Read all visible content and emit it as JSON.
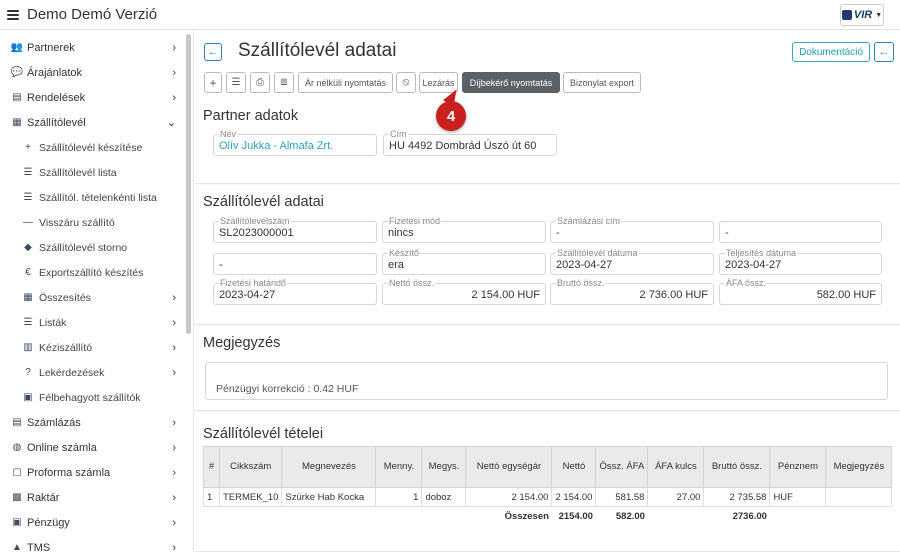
{
  "app": {
    "title": "Demo Demó Verzió",
    "logo_text": "VIR"
  },
  "sidebar": {
    "items": [
      {
        "label": "Partnerek",
        "icon": "users-icon",
        "chevron": "›",
        "sub": false
      },
      {
        "label": "Árajánlatok",
        "icon": "chat-icon",
        "chevron": "›",
        "sub": false
      },
      {
        "label": "Rendelések",
        "icon": "file-icon",
        "chevron": "›",
        "sub": false
      },
      {
        "label": "Szállítólevél",
        "icon": "clipboard-icon",
        "chevron": "⌄",
        "sub": false
      },
      {
        "label": "Szállítólevél készítése",
        "icon": "plus-icon",
        "chevron": "",
        "sub": true
      },
      {
        "label": "Szállítólevél lista",
        "icon": "list-icon",
        "chevron": "",
        "sub": true
      },
      {
        "label": "Szállítól. tételenkénti lista",
        "icon": "list-icon",
        "chevron": "",
        "sub": true
      },
      {
        "label": "Visszáru szállító",
        "icon": "minus-icon",
        "chevron": "",
        "sub": true
      },
      {
        "label": "Szállítólevél storno",
        "icon": "eraser-icon",
        "chevron": "",
        "sub": true
      },
      {
        "label": "Exportszállító készítés",
        "icon": "euro-icon",
        "chevron": "",
        "sub": true
      },
      {
        "label": "Összesítés",
        "icon": "calculator-icon",
        "chevron": "›",
        "sub": true
      },
      {
        "label": "Listák",
        "icon": "list-icon",
        "chevron": "›",
        "sub": true
      },
      {
        "label": "Kéziszállító",
        "icon": "book-icon",
        "chevron": "›",
        "sub": true
      },
      {
        "label": "Lekérdezések",
        "icon": "question-icon",
        "chevron": "›",
        "sub": true
      },
      {
        "label": "Félbehagyott szállítók",
        "icon": "lock-icon",
        "chevron": "",
        "sub": true
      },
      {
        "label": "Számlázás",
        "icon": "invoice-icon",
        "chevron": "›",
        "sub": false
      },
      {
        "label": "Online számla",
        "icon": "globe-icon",
        "chevron": "›",
        "sub": false
      },
      {
        "label": "Proforma számla",
        "icon": "comment-icon",
        "chevron": "›",
        "sub": false
      },
      {
        "label": "Raktár",
        "icon": "warehouse-icon",
        "chevron": "›",
        "sub": false
      },
      {
        "label": "Pénzügy",
        "icon": "money-icon",
        "chevron": "›",
        "sub": false
      },
      {
        "label": "TMS",
        "icon": "truck-icon",
        "chevron": "›",
        "sub": false
      }
    ]
  },
  "header": {
    "title": "Szállítólevél adatai",
    "doc_button": "Dokumentáció"
  },
  "toolbar": {
    "btn_ar_nelkuli": "Ár nélküli nyomtatás",
    "btn_lezaras": "Lezárás",
    "btn_dijbekero": "Díjbekérő nyomtatás",
    "btn_bizonylat": "Bizonylat export"
  },
  "callout": {
    "number": "4"
  },
  "partner": {
    "title": "Partner adatok",
    "name_label": "Név",
    "name_value": "Olív Jukka - Almafa Zrt.",
    "address_label": "Cím",
    "address_value": "HU 4492 Dombrád Úszó út 60"
  },
  "delivery": {
    "title": "Szállítólevél adatai",
    "number_label": "Szállítólevélszám",
    "number_value": "SL2023000001",
    "payment_method_label": "Fizetési mód",
    "payment_method_value": "nincs",
    "billing_address_label": "Számlázási cím",
    "billing_address_value": "-",
    "extra1_value": "-",
    "extra2_value": "-",
    "creator_label": "Készítő",
    "creator_value": "era",
    "date_label": "Szállítólevél dátuma",
    "date_value": "2023-04-27",
    "fulfilment_label": "Teljesítés dátuma",
    "fulfilment_value": "2023-04-27",
    "due_label": "Fizetési határidő",
    "due_value": "2023-04-27",
    "net_label": "Nettó össz.",
    "net_value": "2 154.00 HUF",
    "gross_label": "Bruttó össz.",
    "gross_value": "2 736.00 HUF",
    "vat_label": "ÁFA össz.",
    "vat_value": "582.00 HUF"
  },
  "notes": {
    "title": "Megjegyzés",
    "text": "Pénzügyi korrekció : 0.42 HUF"
  },
  "items": {
    "title": "Szállítólevél tételei",
    "headers": [
      "#",
      "Cikkszám",
      "Megnevezés",
      "Menny.",
      "Megys.",
      "Nettó egységár",
      "Nettó",
      "Össz. ÁFA",
      "ÁFA kulcs",
      "Bruttó össz.",
      "Pénznem",
      "Megjegyzés"
    ],
    "rows": [
      [
        "1",
        "TERMEK_10",
        "Szürke Hab Kocka",
        "1",
        "doboz",
        "2 154.00",
        "2 154.00",
        "581.58",
        "27.00",
        "2 735.58",
        "HUF",
        ""
      ]
    ],
    "total_label": "Összesen",
    "total_net": "2154.00",
    "total_vat": "582.00",
    "total_gross": "2736.00"
  }
}
